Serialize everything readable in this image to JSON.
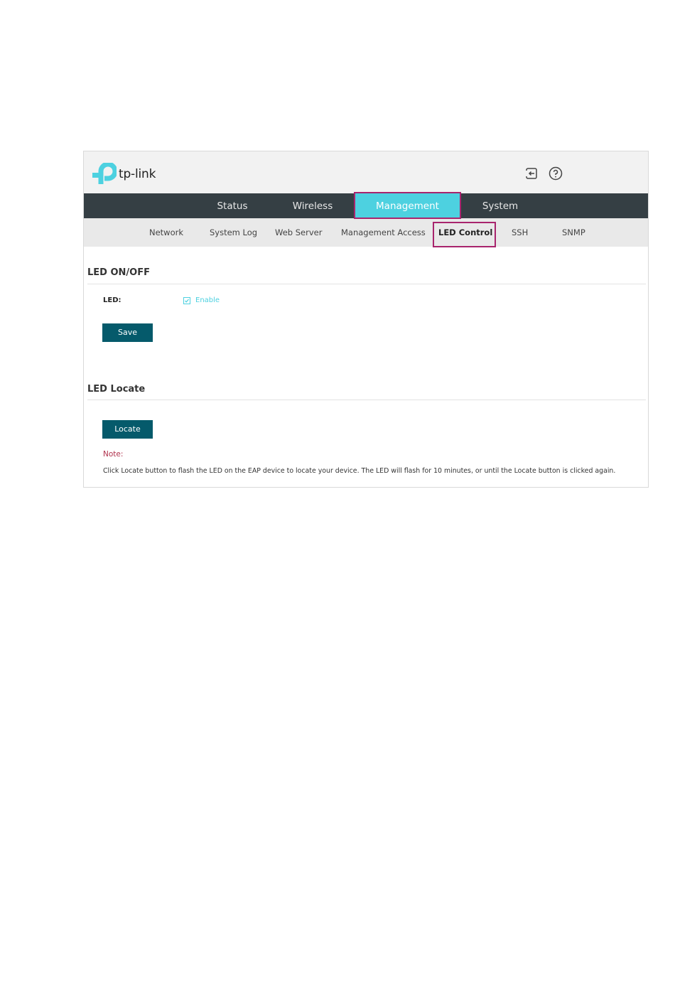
{
  "header": {
    "logo_text": "tp-link",
    "brand_color": "#4dd1e0",
    "icons": [
      "logout-icon",
      "help-icon"
    ]
  },
  "main_nav": {
    "tabs": [
      {
        "label": "Status",
        "active": false
      },
      {
        "label": "Wireless",
        "active": false
      },
      {
        "label": "Management",
        "active": true
      },
      {
        "label": "System",
        "active": false
      }
    ]
  },
  "sub_nav": {
    "items": [
      {
        "label": "Network",
        "active": false
      },
      {
        "label": "System Log",
        "active": false
      },
      {
        "label": "Web Server",
        "active": false
      },
      {
        "label": "Management Access",
        "active": false
      },
      {
        "label": "LED Control",
        "active": true
      },
      {
        "label": "SSH",
        "active": false
      },
      {
        "label": "SNMP",
        "active": false
      }
    ]
  },
  "led_onoff": {
    "title": "LED ON/OFF",
    "field_label": "LED:",
    "checkbox_label": "Enable",
    "checked": true,
    "save_label": "Save"
  },
  "led_locate": {
    "title": "LED Locate",
    "locate_label": "Locate",
    "note_label": "Note:",
    "note_text": "Click Locate button to flash the LED on the EAP device to locate your device. The LED will flash for 10 minutes, or until the Locate button is clicked again."
  },
  "colors": {
    "nav_bg": "#353f44",
    "active_tab": "#4dd1e0",
    "button": "#055a6b",
    "highlight_box": "#a8246d",
    "note": "#b0314c"
  }
}
